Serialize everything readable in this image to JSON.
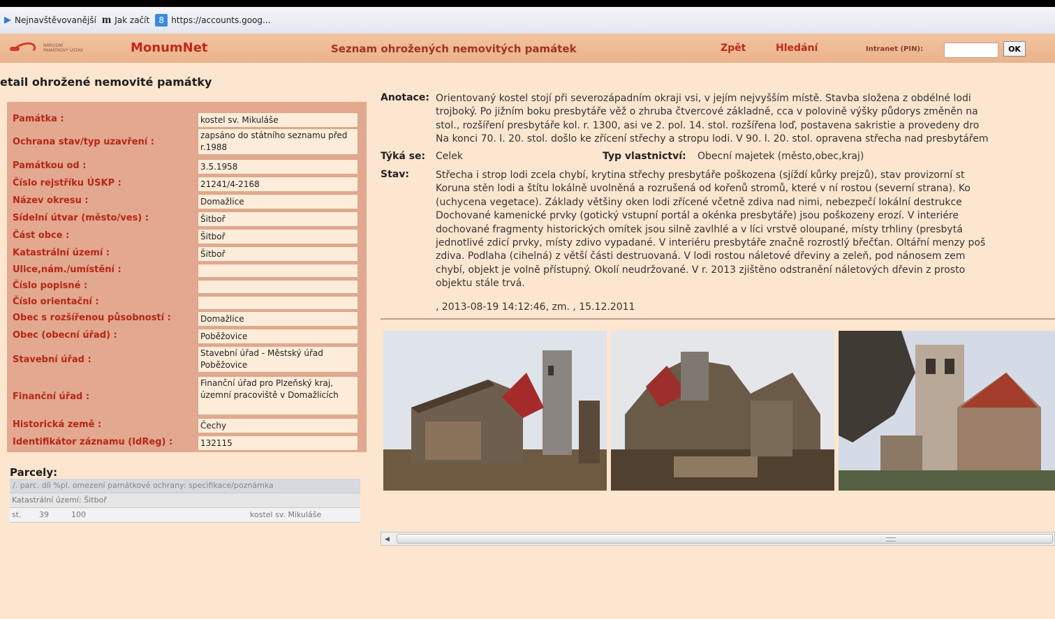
{
  "bookmarks": [
    {
      "icon": "arrow-icon",
      "label": "Nejnavštěvovanější"
    },
    {
      "icon": "m-logo-icon",
      "label": "Jak začít"
    },
    {
      "icon": "google-8-icon",
      "label": "https://accounts.goog..."
    }
  ],
  "header": {
    "brand": "MonumNet",
    "title": "Seznam ohrožených nemovitých památek",
    "back_link": "Zpět",
    "search_link": "Hledání",
    "pin_label": "Intranet (PIN):",
    "pin_value": "",
    "ok_label": "OK"
  },
  "page_title": "etail ohrožené nemovité památky",
  "fields": [
    {
      "label": "Památka :",
      "value": "kostel sv. Mikuláše"
    },
    {
      "label": "Ochrana stav/typ uzavření :",
      "value": "zapsáno do státního seznamu před r.1988"
    },
    {
      "label": "Památkou od :",
      "value": "3.5.1958"
    },
    {
      "label": "Číslo rejstříku ÚSKP :",
      "value": "21241/4-2168"
    },
    {
      "label": "Název okresu :",
      "value": "Domažlice"
    },
    {
      "label": "Sídelní útvar (město/ves) :",
      "value": "Šitboř"
    },
    {
      "label": "Část obce :",
      "value": "Šitboř"
    },
    {
      "label": "Katastrální území :",
      "value": "Šitboř"
    },
    {
      "label": "Ulice,nám./umístění :",
      "value": ""
    },
    {
      "label": "Číslo popisné :",
      "value": ""
    },
    {
      "label": "Číslo orientační :",
      "value": ""
    },
    {
      "label": "Obec s rozšířenou působností :",
      "value": "Domažlice"
    },
    {
      "label": "Obec (obecní úřad) :",
      "value": "Poběžovice"
    },
    {
      "label": "Stavební úřad :",
      "value": "Stavební úřad - Městský úřad Poběžovice"
    },
    {
      "label": "Finanční úřad :",
      "value": "Finanční úřad pro Plzeňský kraj, územní pracoviště v Domažlicích"
    },
    {
      "label": "Historická země :",
      "value": "Čechy"
    },
    {
      "label": "Identifikátor záznamu (IdReg) :",
      "value": "132115"
    }
  ],
  "parcely": {
    "title": "Parcely:",
    "header": "/. parc. díl %pl. omezení památkové ochrany: specifikace/poznámka",
    "subheader": "Katastrální území: Šitboř",
    "row": {
      "type": "st.",
      "number": "39",
      "share": "100",
      "note": "kostel sv. Mikuláše"
    }
  },
  "info": {
    "anotace_label": "Anotace:",
    "anotace_lines": [
      "Orientovaný kostel stojí při severozápadním okraji vsi, v jejím nejvyšším místě. Stavba složena z obdélné lodi",
      "trojboký. Po jižním boku presbytáře věž o zhruba čtvercové základně, cca v polovině výšky půdorys změněn na",
      "stol., rozšíření presbytáře kol. r. 1300, asi ve 2. pol. 14. stol. rozšířena loď, postavena sakristie a provedeny dro",
      "Na konci 70. l. 20. stol. došlo ke zřícení střechy a stropu lodi. V 90. l. 20. stol. opravena střecha nad presbytářem"
    ],
    "tyka_se_label": "Týká se:",
    "tyka_se_value": "Celek",
    "typ_label": "Typ vlastnictví:",
    "typ_value": "Obecní majetek (město,obec,kraj)",
    "stav_label": "Stav:",
    "stav_lines": [
      "Střecha i strop lodi zcela chybí, krytina střechy presbytáře poškozena (sjíždí kůrky prejzů), stav provizorní st",
      "Koruna stěn lodi a štítu lokálně uvolněná a rozrušená od kořenů stromů, které v ní rostou (severní strana). Ko",
      "(uchycena vegetace). Základy většiny oken lodi zřícené včetně zdiva nad nimi, nebezpečí lokální destrukce",
      "Dochované kamenické prvky (gotický vstupní portál a okénka presbytáře) jsou poškozeny erozí. V interiére",
      "dochované fragmenty historických omítek jsou silně zavlhlé a v líci vrstvě oloupané, místy trhliny (presbytá",
      "jednotlivé zdicí prvky, místy zdivo vypadané. V interiéru presbytáře značně rozrostlý břečťan. Oltářní menzy poš",
      "zdiva. Podlaha (cihelná) z větší části destruovaná. V lodi rostou náletové dřeviny a zeleň, pod nánosem zem",
      "chybí, objekt je volně přístupný. Okolí neudržované. V r. 2013 zjištěno odstranění náletových dřevin z prosto",
      "objektu stále trvá."
    ],
    "footer": ", 2013-08-19 14:12:46, zm. , 15.12.2011"
  },
  "colors": {
    "page_bg": "#fde6cf",
    "header_bg": "#eebb95",
    "brand": "#c0281b",
    "form_bg": "#e3a890",
    "label": "#b62616"
  }
}
